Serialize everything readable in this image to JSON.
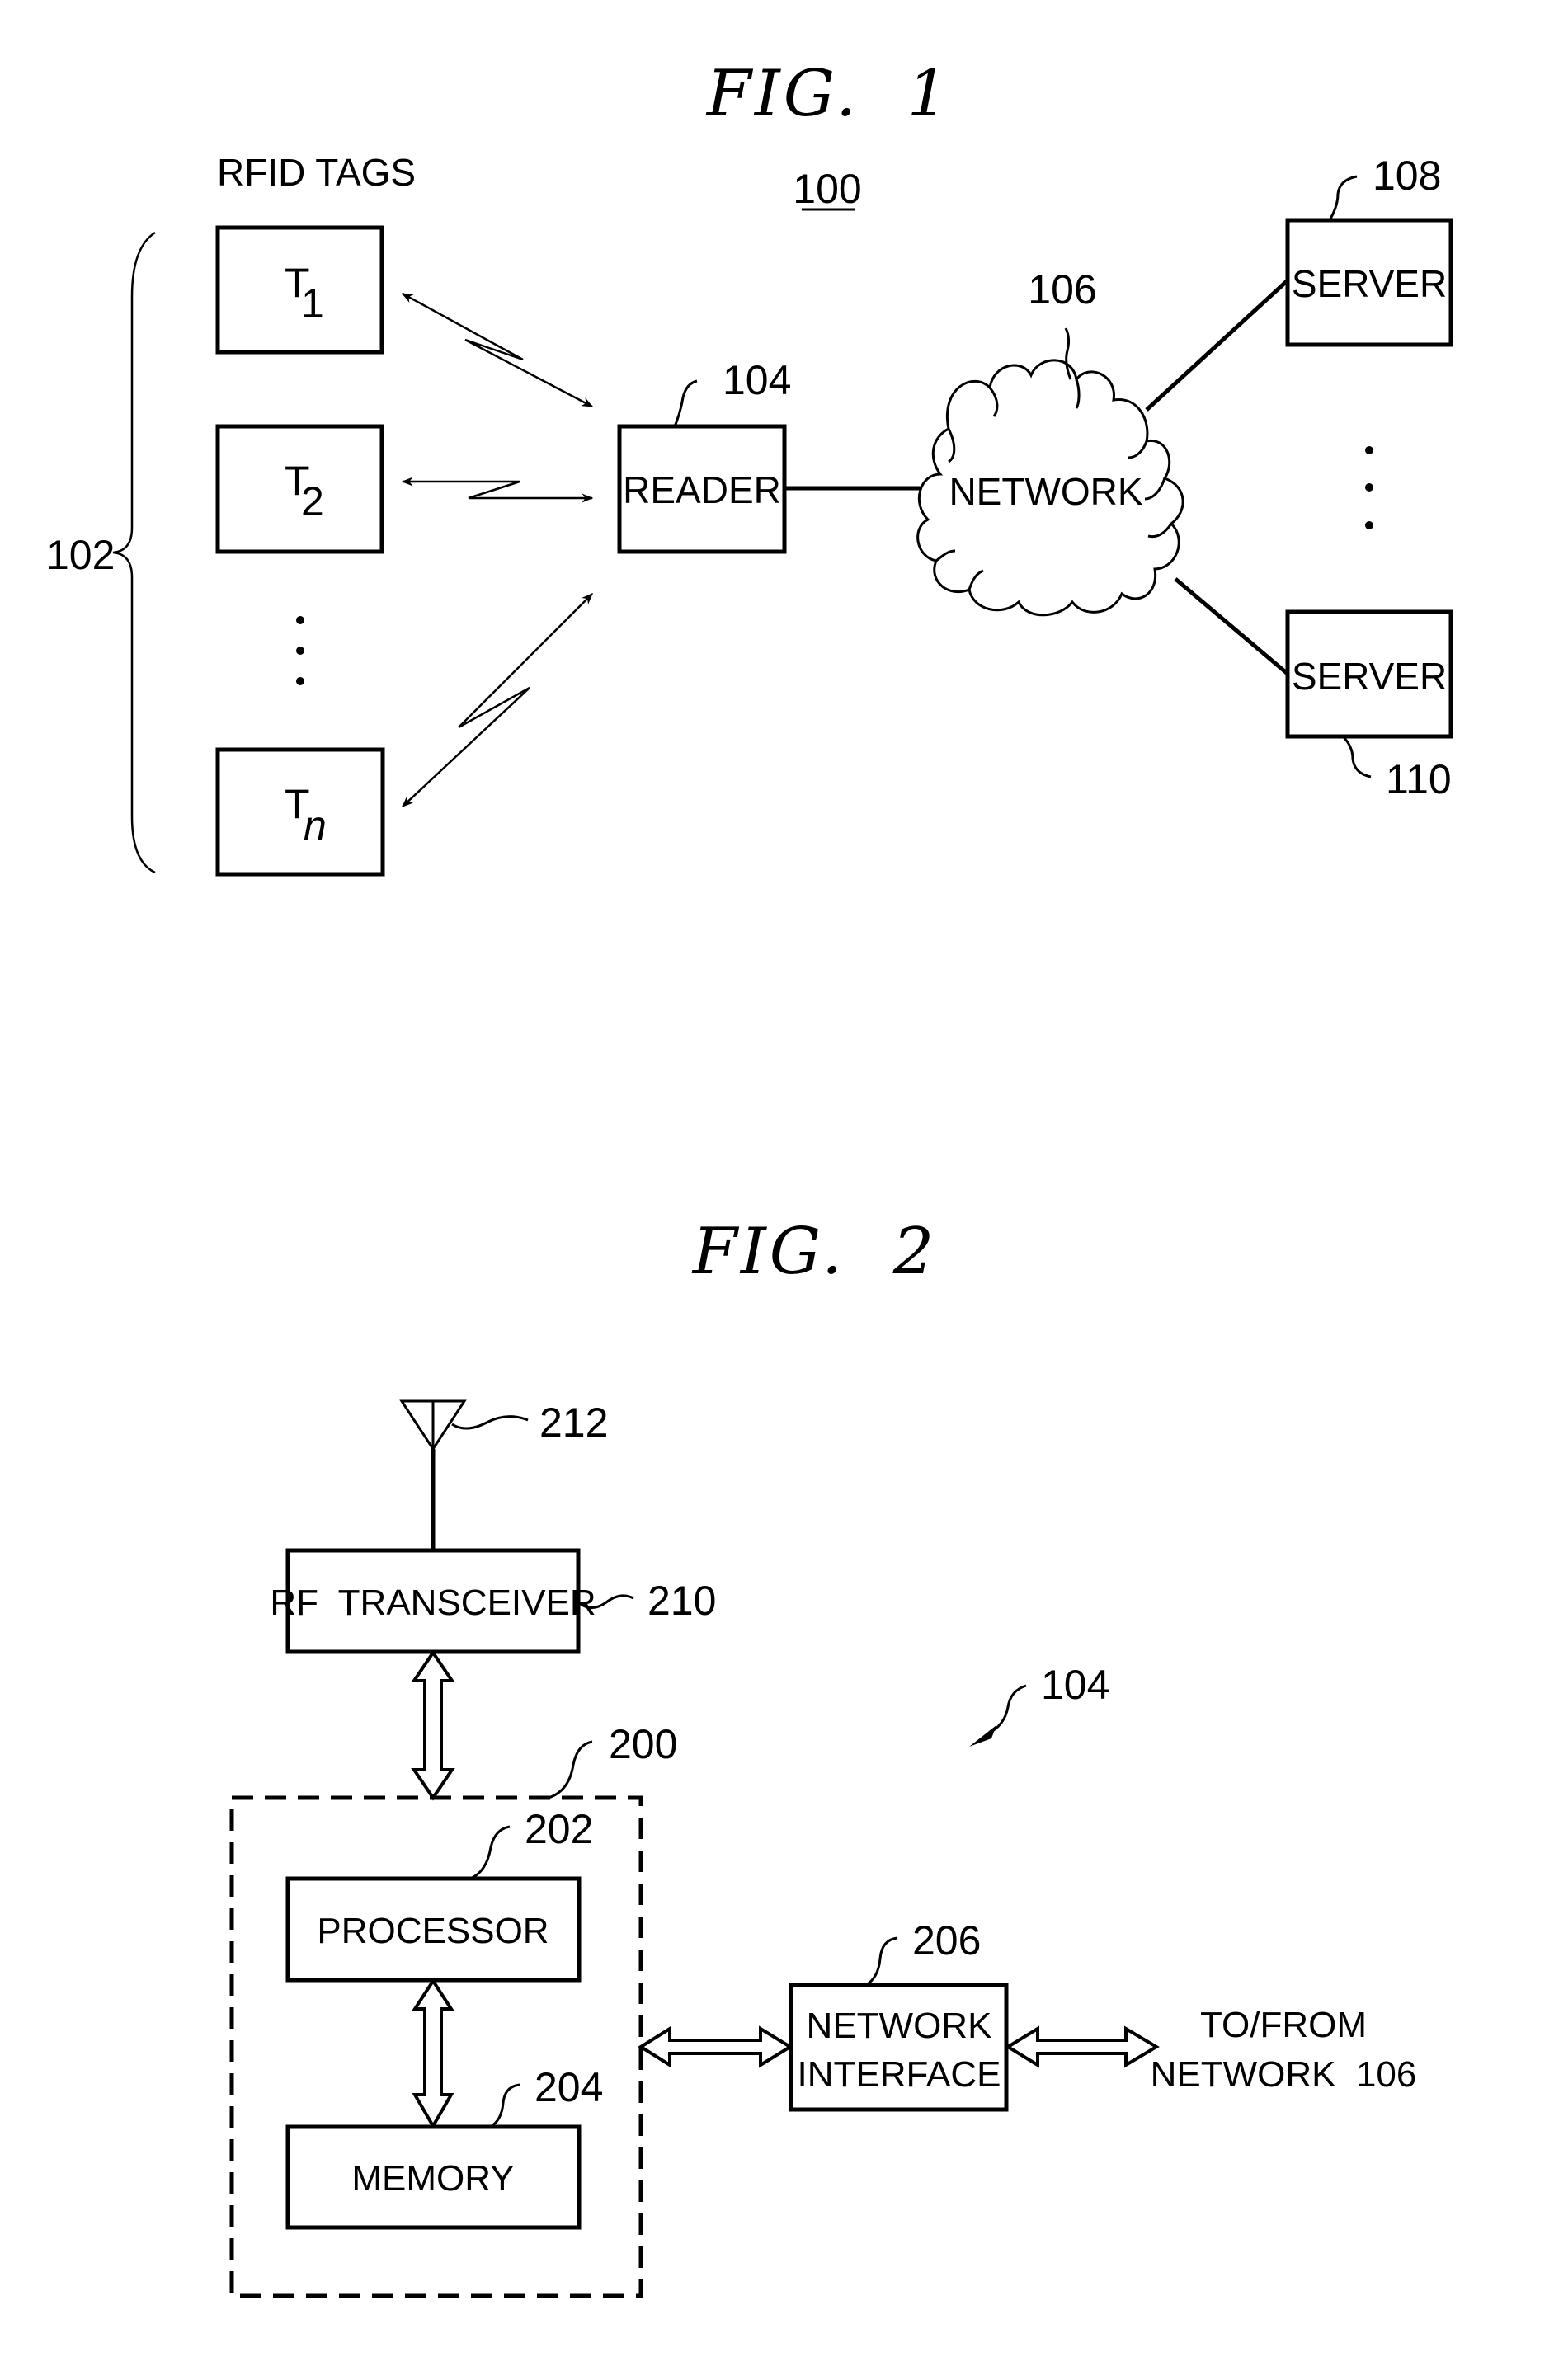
{
  "fig1": {
    "title": "FIG.  1",
    "ref_system": "100",
    "tags_heading": "RFID TAGS",
    "tags_group_ref": "102",
    "tags": [
      {
        "main": "T",
        "sub": "1"
      },
      {
        "main": "T",
        "sub": "2"
      },
      {
        "main": "T",
        "sub": "n"
      }
    ],
    "reader": {
      "label": "READER",
      "ref": "104"
    },
    "network": {
      "label": "NETWORK",
      "ref": "106"
    },
    "servers": [
      {
        "label": "SERVER",
        "ref": "108"
      },
      {
        "label": "SERVER",
        "ref": "110"
      }
    ]
  },
  "fig2": {
    "title": "FIG.  2",
    "overall_ref": "104",
    "antenna_ref": "212",
    "rf_transceiver": {
      "label": "RF  TRANSCEIVER",
      "ref": "210"
    },
    "controller_ref": "200",
    "processor": {
      "label": "PROCESSOR",
      "ref": "202"
    },
    "memory": {
      "label": "MEMORY",
      "ref": "204"
    },
    "network_interface": {
      "line1": "NETWORK",
      "line2": "INTERFACE",
      "ref": "206"
    },
    "external": {
      "line1": "TO/FROM",
      "line2": "NETWORK  106"
    }
  }
}
